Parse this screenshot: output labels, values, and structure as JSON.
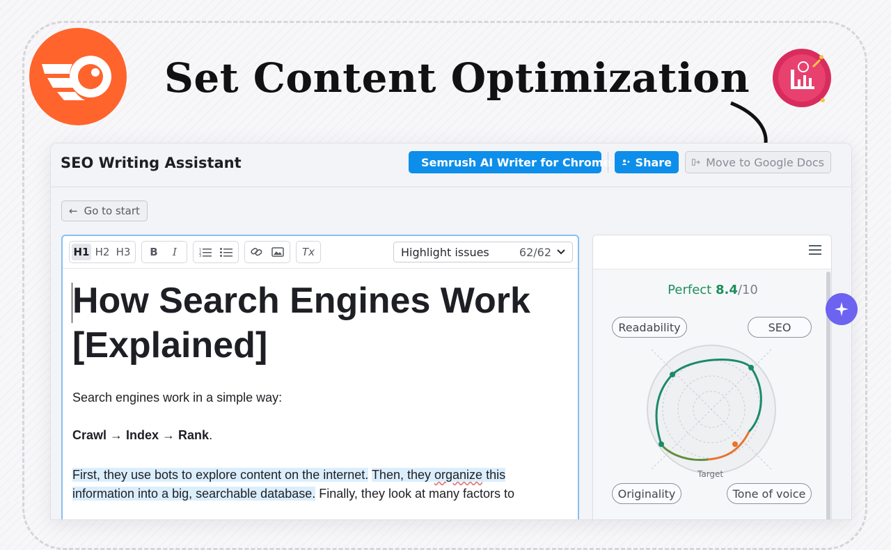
{
  "headline": "Set Content Optimization",
  "brand_color": "#ff642d",
  "icons": {
    "logo": "semrush-comet-logo-icon",
    "badge": "analytics-chart-badge-icon",
    "arrow": "curved-arrow-icon"
  },
  "app": {
    "title": "SEO Writing Assistant",
    "buttons": {
      "chrome": "Semrush AI Writer for Chrome",
      "share": "Share",
      "move": "Move to Google Docs"
    },
    "go_to_start": "Go to start"
  },
  "editor": {
    "toolbar": {
      "h1": "H1",
      "h2": "H2",
      "h3": "H3",
      "bold": "B",
      "italic": "I",
      "clear": "Tx"
    },
    "highlight_select": {
      "label": "Highlight issues",
      "count": "62/62"
    },
    "document": {
      "title_line1": "How Search Engines Work",
      "title_line2": "[Explained]",
      "p1": "Search engines work in a simple way:",
      "p2_bold": "Crawl → Index → Rank",
      "p2_end": ".",
      "p3_part1": "First, they use bots to explore content on the internet.",
      "p3_part2a": "Then, they",
      "p3_underlined": "organize",
      "p3_part2b": "this",
      "p3_part3": "information into a big, searchable database.",
      "p3_part4": "Finally, they look at many factors to"
    }
  },
  "panel": {
    "score_label": "Perfect",
    "score_value": "8.4",
    "score_max": "/10",
    "score_color": "#1d8f5b",
    "pills": {
      "readability": "Readability",
      "seo": "SEO",
      "originality": "Originality",
      "tone": "Tone of voice"
    },
    "target_label": "Target"
  }
}
